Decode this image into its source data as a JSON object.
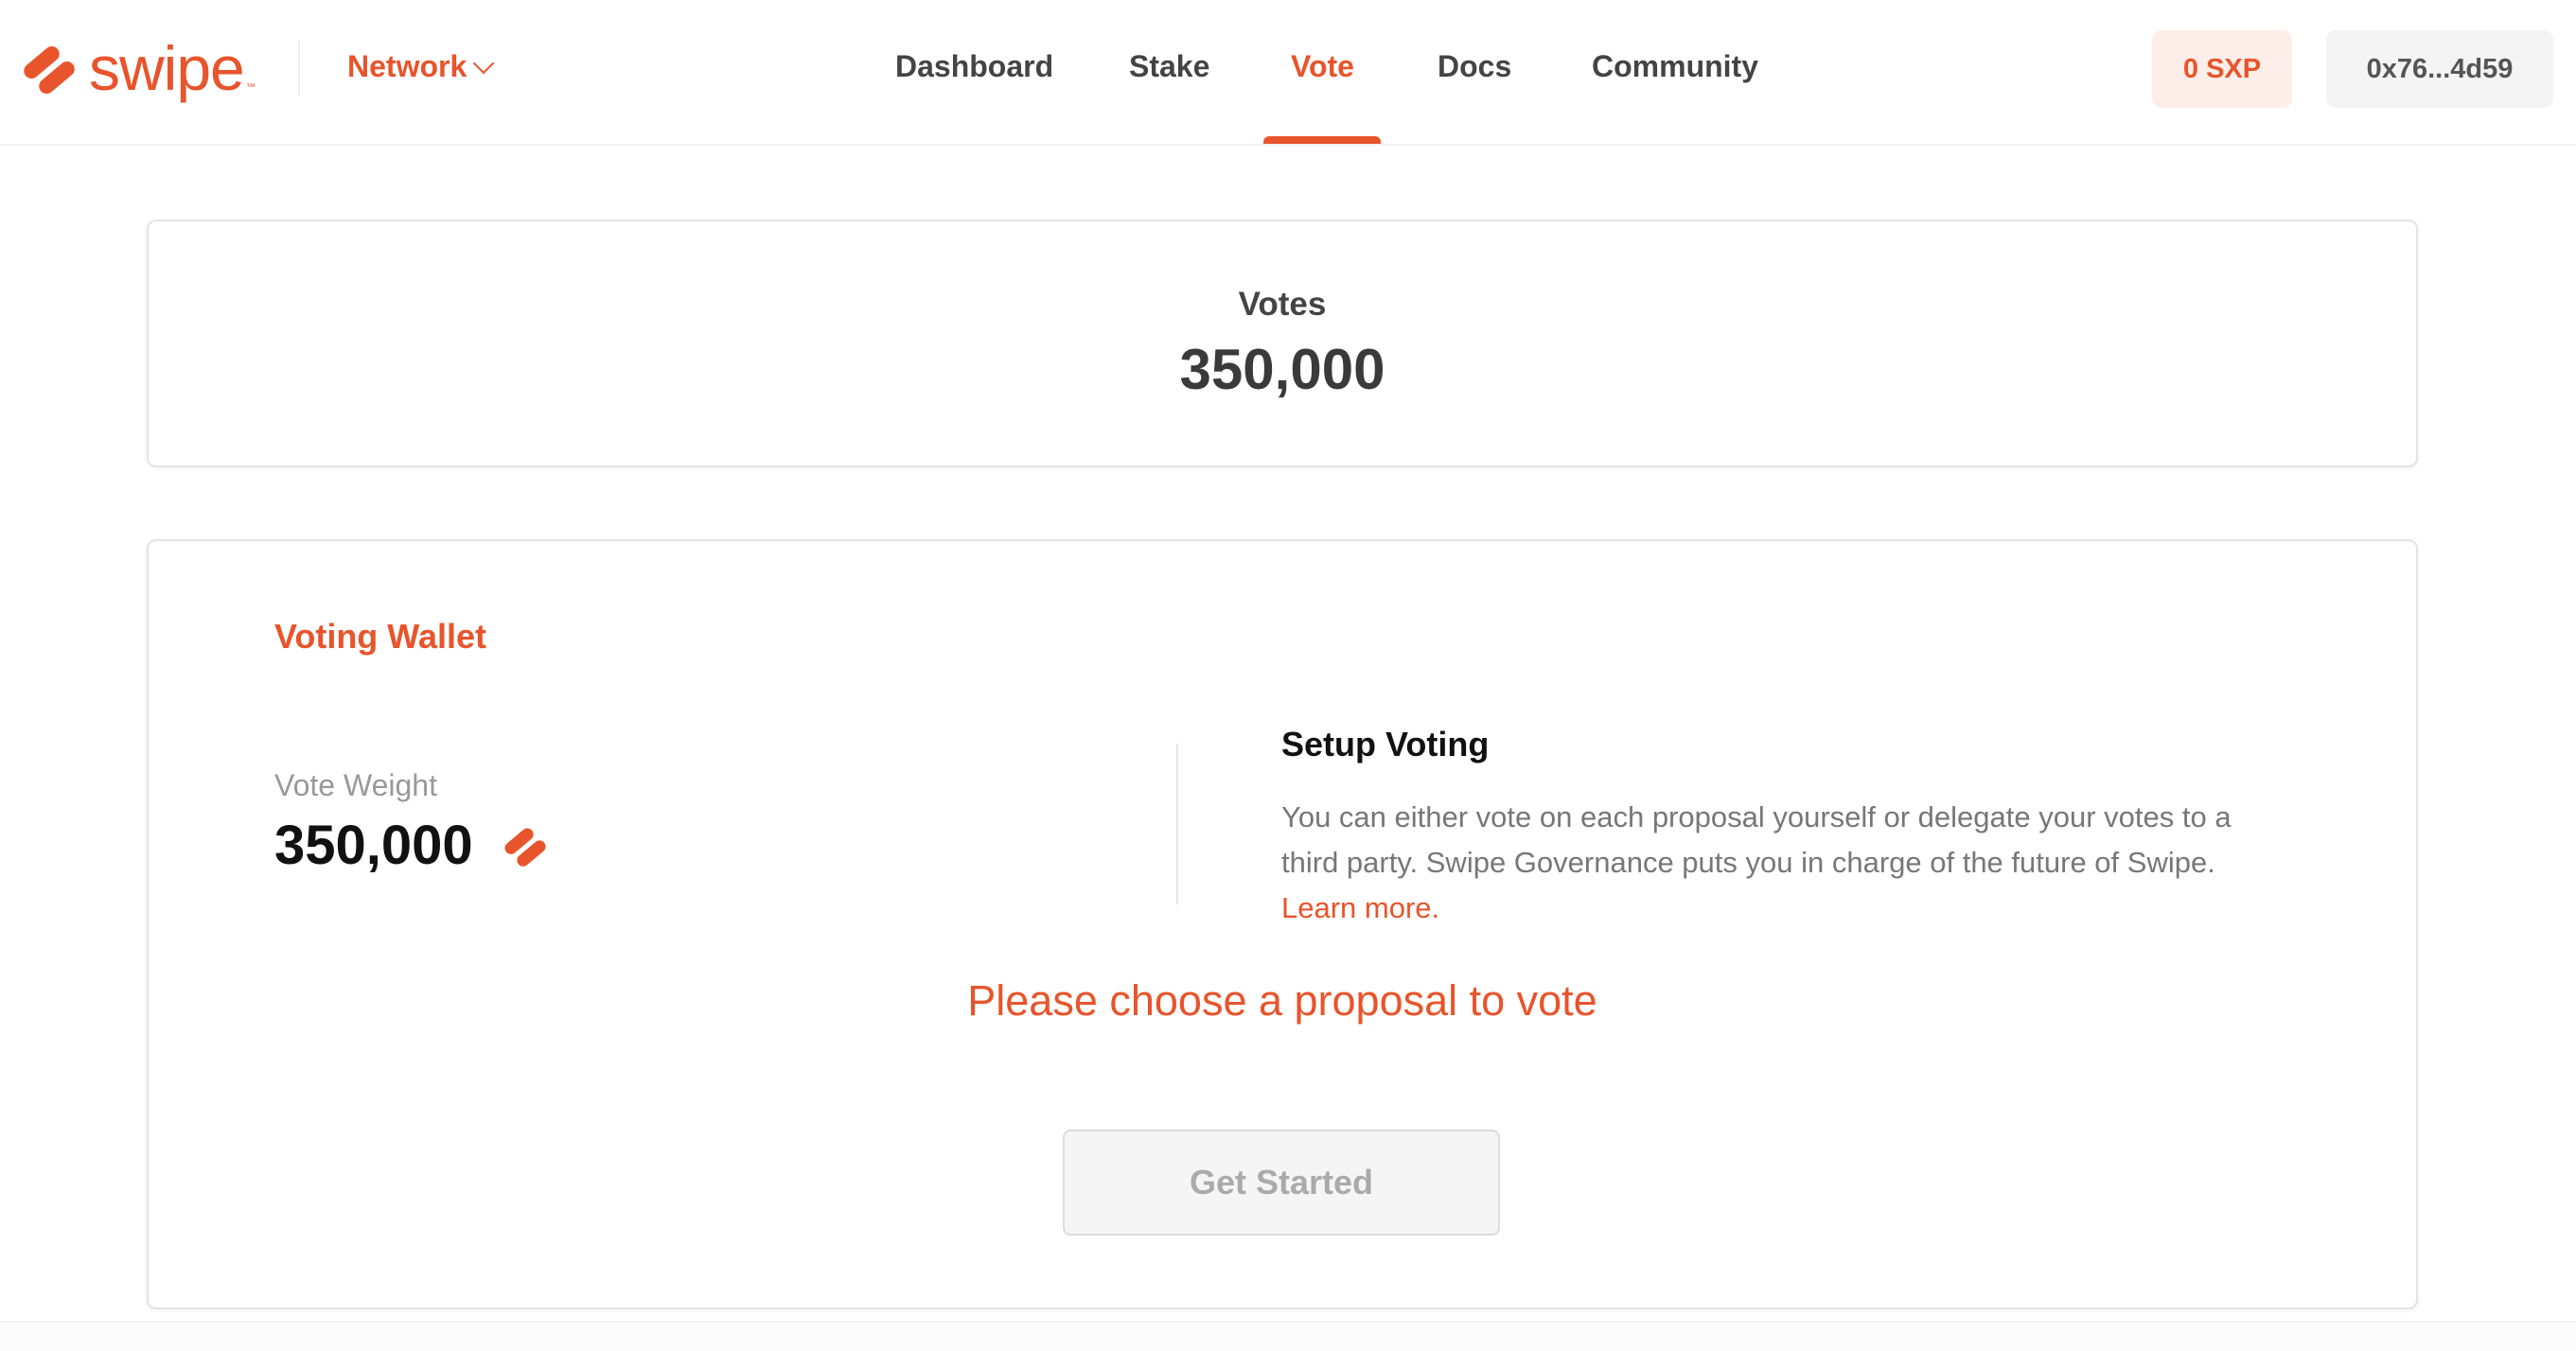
{
  "brand": {
    "name": "swipe",
    "tm": "™",
    "accent": "#e8542b"
  },
  "header": {
    "network_label": "Network",
    "nav": [
      {
        "label": "Dashboard",
        "active": false
      },
      {
        "label": "Stake",
        "active": false
      },
      {
        "label": "Vote",
        "active": true
      },
      {
        "label": "Docs",
        "active": false
      },
      {
        "label": "Community",
        "active": false
      }
    ],
    "balance": "0 SXP",
    "address": "0x76...4d59"
  },
  "votes_card": {
    "label": "Votes",
    "value": "350,000"
  },
  "wallet": {
    "title": "Voting Wallet",
    "weight_label": "Vote Weight",
    "weight_value": "350,000",
    "weight_icon": "swipe-logo-icon",
    "setup_title": "Setup Voting",
    "setup_text": "You can either vote on each proposal yourself or delegate your votes to a third party. Swipe Governance puts you in charge of the future of Swipe.",
    "learn_more": "Learn more.",
    "choose_message": "Please choose a proposal to vote",
    "get_started": "Get Started"
  }
}
